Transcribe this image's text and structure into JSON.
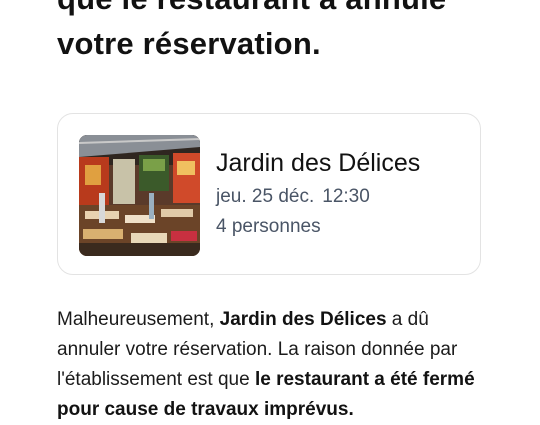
{
  "headline": {
    "line1": "que le restaurant a annulé",
    "line2": "votre réservation."
  },
  "reservation": {
    "restaurant_name": "Jardin des Délices",
    "date": "jeu. 25 déc.",
    "time": "12:30",
    "party_size": "4 personnes",
    "photo_icon": "restaurant-interior-photo"
  },
  "message": {
    "intro": "Malheureusement, ",
    "restaurant_name": "Jardin des Délices",
    "text_after_name": " a dû annuler votre réservation. La raison donnée par l'établissement est que ",
    "reason_bold": "le restaurant a été",
    "reason_cont": "fermé pour cause de travaux imprévus."
  },
  "colors": {
    "text": "#121212",
    "muted": "#4a5566",
    "card_border": "#e3e3e3"
  }
}
